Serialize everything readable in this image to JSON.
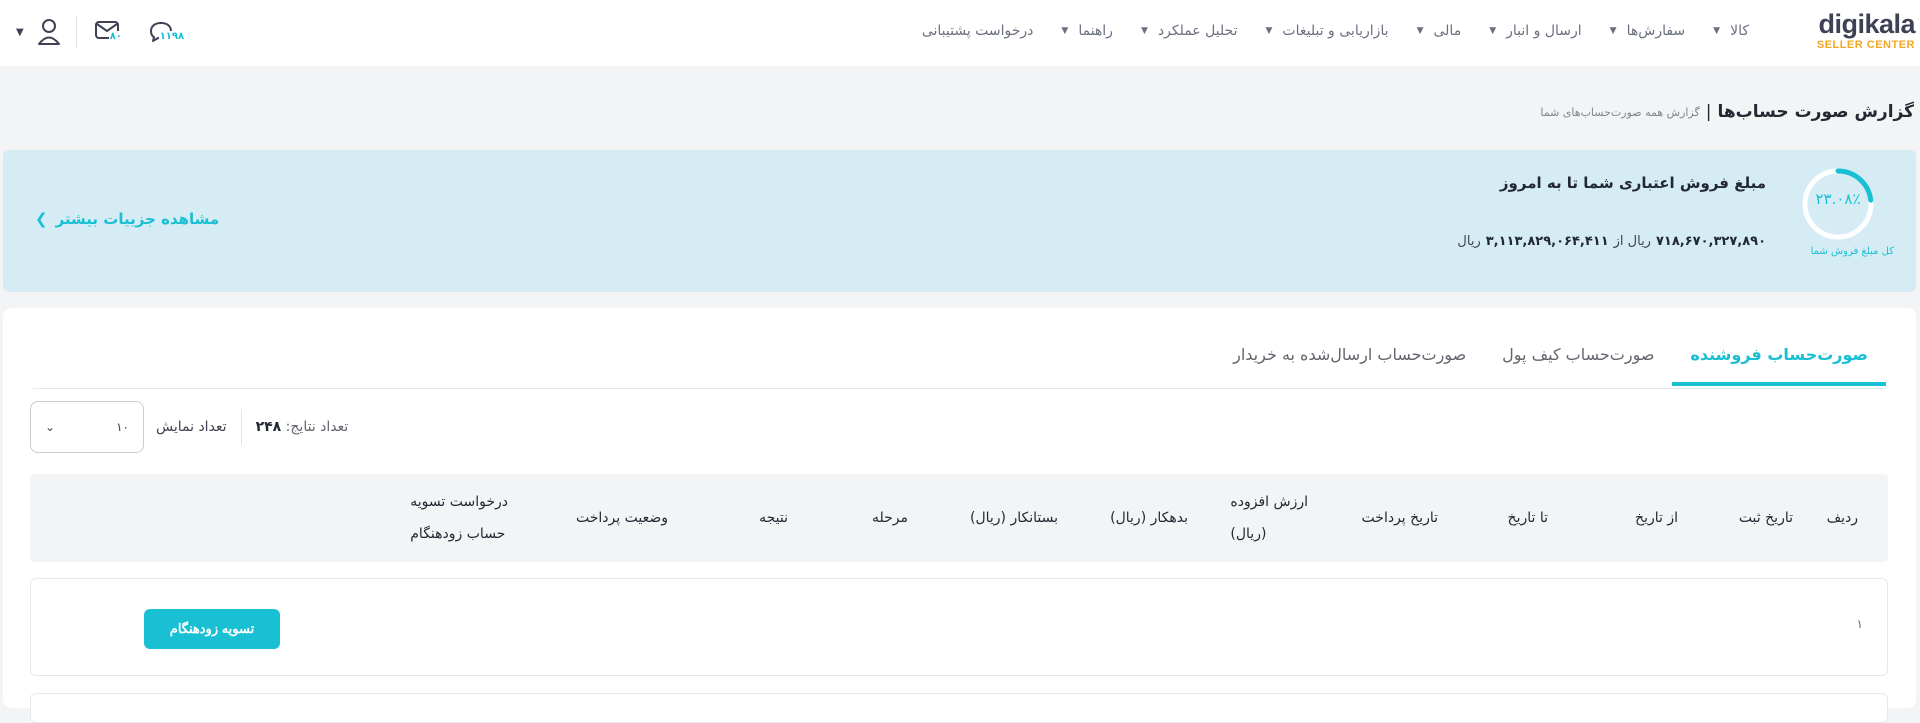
{
  "header": {
    "logo_main": "digikala",
    "logo_sub": "SELLER CENTER",
    "nav": [
      {
        "label": "کالا"
      },
      {
        "label": "سفارش‌ها"
      },
      {
        "label": "ارسال و انبار"
      },
      {
        "label": "مالی"
      },
      {
        "label": "بازاریابی و تبلیغات"
      },
      {
        "label": "تحلیل عملکرد"
      },
      {
        "label": "راهنما"
      },
      {
        "label": "درخواست پشتیبانی"
      }
    ],
    "messages_badge": "۸۰",
    "notifications_badge": "۱۱۹۸",
    "icons": {
      "user": "user-icon",
      "messages": "mail-icon",
      "notifications": "chat-icon",
      "caret": "caret-down-icon"
    }
  },
  "breadcrumb": {
    "title": "گزارش صورت حساب‌ها",
    "separator": "|",
    "subtitle": "گزارش همه صورت‌حساب‌های شما"
  },
  "credit": {
    "gauge_percent": "۲۳.۰۸٪",
    "gauge_fraction": 0.2308,
    "gauge_label": "کل مبلغ فروش شما",
    "title": "مبلغ فروش اعتباری شما تا به امروز",
    "amount": "۷۱۸,۶۷۰,۳۲۷,۸۹۰",
    "currency_word": "ریال از",
    "total": "۳,۱۱۳,۸۲۹,۰۶۴,۴۱۱",
    "total_currency": "ریال",
    "more_link": "مشاهده جزییات بیشتر"
  },
  "tabs": [
    {
      "label": "صورت‌حساب فروشنده",
      "active": true
    },
    {
      "label": "صورت‌حساب کیف پول",
      "active": false
    },
    {
      "label": "صورت‌حساب ارسال‌شده به خریدار",
      "active": false
    }
  ],
  "controls": {
    "results_label": "تعداد نتایج:",
    "results_count": "۲۴۸",
    "per_page_label": "تعداد نمایش",
    "per_page_value": "۱۰"
  },
  "table": {
    "headers": {
      "row": "ردیف",
      "reg_date": "تاریخ ثبت",
      "from_date": "از تاریخ",
      "to_date": "تا تاریخ",
      "pay_date": "تاریخ پرداخت",
      "vat_line1": "ارزش افزوده",
      "vat_line2": "(ریال)",
      "debit": "بدهکار (ریال)",
      "credit": "بستانکار (ریال)",
      "stage": "مرحله",
      "result": "نتیجه",
      "pay_status": "وضعیت پرداخت",
      "early_line1": "درخواست تسویه",
      "early_line2": "حساب زودهنگام"
    },
    "rows": [
      {
        "num": "۱",
        "action_label": "تسویه زودهنگام"
      }
    ]
  },
  "colors": {
    "accent": "#19bfd3",
    "logo_accent": "#f5a623",
    "banner_bg": "#d6ecf5"
  }
}
